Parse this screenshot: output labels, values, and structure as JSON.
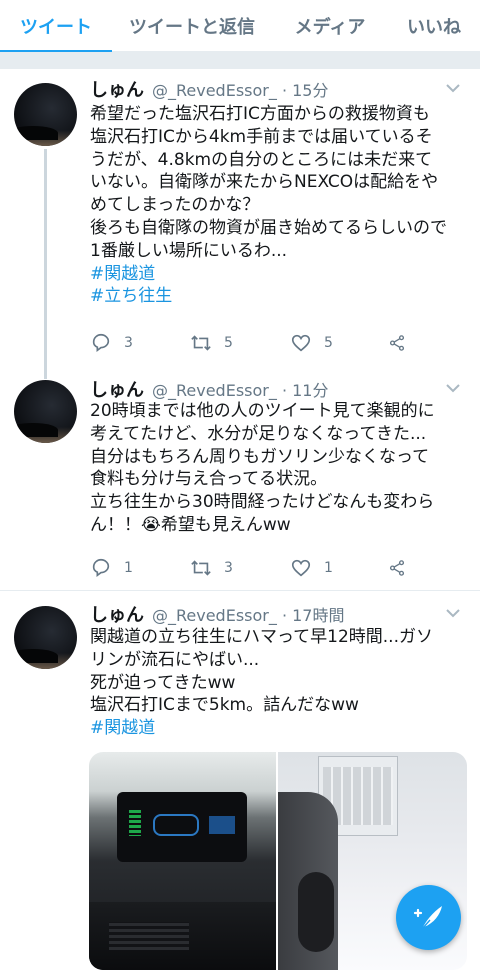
{
  "tabs": [
    {
      "label": "ツイート",
      "active": true
    },
    {
      "label": "ツイートと返信",
      "active": false
    },
    {
      "label": "メディア",
      "active": false
    },
    {
      "label": "いいね",
      "active": false
    }
  ],
  "tweets": [
    {
      "name": "しゅん",
      "handle_time": "@_RevedEssor_ · 15分",
      "lines": [
        "希望だった塩沢石打IC方面からの救援物資も",
        "塩沢石打ICから4km手前までは届いているそ",
        "うだが、4.8kmの自分のところには未だ来て",
        "いない。自衛隊が来たからNEXCOは配給をや",
        "めてしまったのかな？",
        "後ろも自衛隊の物資が届き始めてるらしいので",
        "1番厳しい場所にいるわ..."
      ],
      "hashtags": [
        "#関越道",
        "#立ち往生"
      ],
      "replies": "3",
      "retweets": "5",
      "likes": "5"
    },
    {
      "name": "しゅん",
      "handle_time": "@_RevedEssor_ · 11分",
      "lines": [
        "20時頃までは他の人のツイート見て楽観的に",
        "考えてたけど、水分が足りなくなってきた...",
        "自分はもちろん周りもガソリン少なくなって",
        "食料も分け与え合ってる状況。",
        "立ち往生から30時間経ったけどなんも変わら",
        "ん！！😭希望も見えんww"
      ],
      "hashtags": [],
      "replies": "1",
      "retweets": "3",
      "likes": "1"
    },
    {
      "name": "しゅん",
      "handle_time": "@_RevedEssor_ · 17時間",
      "lines": [
        "関越道の立ち往生にハマって早12時間...ガソ",
        "リンが流石にやばい...",
        "死が迫ってきたww",
        "塩沢石打ICまで5km。詰んだなww"
      ],
      "hashtags": [
        "#関越道"
      ],
      "media_count": 2
    }
  ],
  "colors": {
    "accent": "#1da1f2",
    "hashtag": "#1b95e0",
    "muted": "#657786",
    "separator": "#e6ecf0"
  },
  "icons": [
    "reply-icon",
    "retweet-icon",
    "like-icon",
    "share-icon",
    "chevron-down-icon",
    "compose-tweet-icon"
  ]
}
